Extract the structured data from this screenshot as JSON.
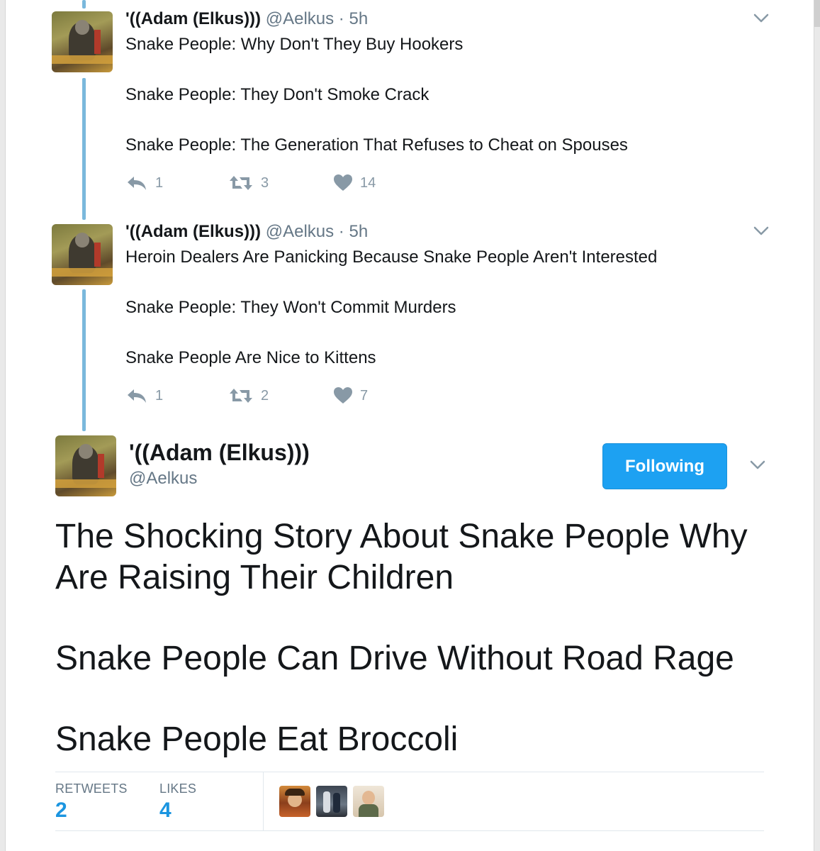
{
  "thread": [
    {
      "name": "'((Adam (Elkus)))",
      "handle": "@Aelkus",
      "dot": "·",
      "time": "5h",
      "lines": [
        "Snake People: Why Don't They Buy Hookers",
        "Snake People: They Don't Smoke Crack",
        "Snake People: The Generation That Refuses to Cheat on Spouses"
      ],
      "replies": "1",
      "retweets": "3",
      "likes": "14"
    },
    {
      "name": "'((Adam (Elkus)))",
      "handle": "@Aelkus",
      "dot": "·",
      "time": "5h",
      "lines": [
        "Heroin Dealers Are Panicking Because Snake People Aren't Interested",
        "Snake People: They Won't Commit Murders",
        "Snake People Are Nice to Kittens"
      ],
      "replies": "1",
      "retweets": "2",
      "likes": "7"
    }
  ],
  "main_tweet": {
    "name": "'((Adam (Elkus)))",
    "handle": "@Aelkus",
    "follow_label": "Following",
    "paragraphs": [
      "The Shocking Story About Snake People Why Are Raising Their Children",
      "Snake People Can Drive Without Road Rage",
      "Snake People Eat Broccoli"
    ],
    "stats": {
      "retweets_label": "RETWEETS",
      "retweets_value": "2",
      "likes_label": "LIKES",
      "likes_value": "4"
    }
  },
  "icons": {
    "reply": "reply-icon",
    "retweet": "retweet-icon",
    "like": "heart-icon",
    "more": "chevron-down-icon"
  },
  "colors": {
    "thread_line": "#7ab8dc",
    "follow_button": "#1da1f2",
    "stat_value": "#1b95e0",
    "action_gray": "#8899a6"
  }
}
